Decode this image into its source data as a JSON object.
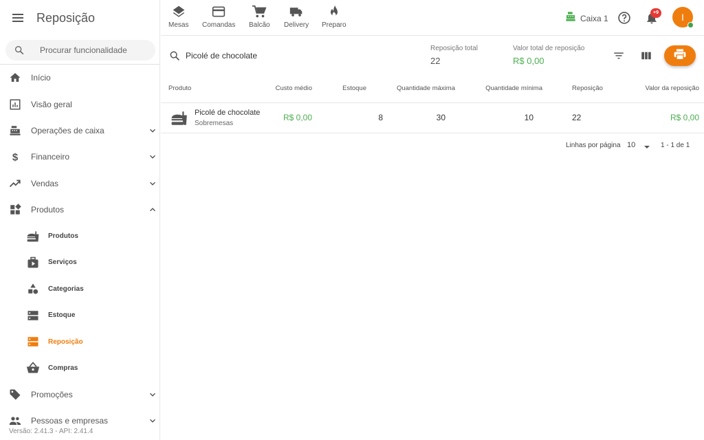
{
  "app": {
    "title": "Reposição"
  },
  "sidebar": {
    "search_placeholder": "Procurar funcionalidade",
    "items": [
      {
        "label": "Início",
        "icon": "home-icon"
      },
      {
        "label": "Visão geral",
        "icon": "bar-chart-icon"
      },
      {
        "label": "Operações de caixa",
        "icon": "cash-register-icon"
      },
      {
        "label": "Financeiro",
        "icon": "dollar-icon"
      },
      {
        "label": "Vendas",
        "icon": "trending-up-icon"
      },
      {
        "label": "Produtos",
        "icon": "dashboard-icon"
      },
      {
        "label": "Produtos",
        "icon": "fastfood-icon"
      },
      {
        "label": "Serviços",
        "icon": "video-box-icon"
      },
      {
        "label": "Categorias",
        "icon": "shapes-icon"
      },
      {
        "label": "Estoque",
        "icon": "storage-icon"
      },
      {
        "label": "Reposição",
        "icon": "storage-icon"
      },
      {
        "label": "Compras",
        "icon": "basket-icon"
      },
      {
        "label": "Promoções",
        "icon": "tag-icon"
      },
      {
        "label": "Pessoas e empresas",
        "icon": "people-icon"
      }
    ],
    "version": "Versão: 2.41.3 - API: 2.41.4"
  },
  "topbar": {
    "quick_actions": [
      {
        "label": "Mesas",
        "icon": "layers-icon"
      },
      {
        "label": "Comandas",
        "icon": "card-icon"
      },
      {
        "label": "Balcão",
        "icon": "cart-icon"
      },
      {
        "label": "Delivery",
        "icon": "truck-icon"
      },
      {
        "label": "Preparo",
        "icon": "fire-icon"
      }
    ],
    "caixa_label": "Caixa 1",
    "notification_badge": "+9",
    "avatar_initial": "I"
  },
  "main": {
    "search_value": "Picolé de chocolate",
    "stats": {
      "total_label": "Reposição total",
      "total_value": "22",
      "value_label": "Valor total de reposição",
      "value_value": "R$ 0,00"
    },
    "table": {
      "headers": {
        "produto": "Produto",
        "custo": "Custo médio",
        "estoque": "Estoque",
        "qmax": "Quantidade máxima",
        "qmin": "Quantidade mínima",
        "reposicao": "Reposição",
        "valor": "Valor da reposição"
      },
      "rows": [
        {
          "name": "Picolé de chocolate",
          "category": "Sobremesas",
          "custo": "R$ 0,00",
          "estoque": "8",
          "qmax": "30",
          "qmin": "10",
          "reposicao": "22",
          "valor": "R$ 0,00"
        }
      ]
    },
    "pagination": {
      "rows_label": "Linhas por página",
      "rows_value": "10",
      "range": "1 - 1 de 1"
    }
  },
  "colors": {
    "accent": "#ef7d0e",
    "positive": "#4caf50",
    "badge": "#e53935",
    "online": "#43a047"
  }
}
